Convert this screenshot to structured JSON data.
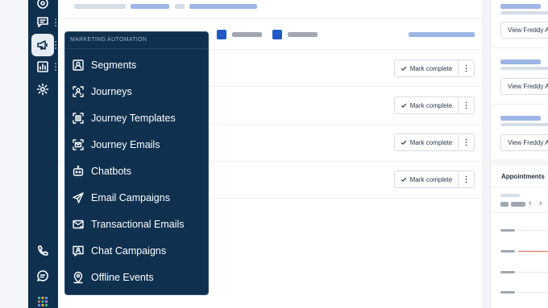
{
  "rail": {
    "icons": [
      "help-icon",
      "chat-icon",
      "megaphone-icon",
      "reports-icon",
      "settings-icon",
      "phone-icon",
      "message-icon",
      "apps-grid-icon"
    ]
  },
  "menu": {
    "section_title": "MARKETING AUTOMATION",
    "items": [
      {
        "label": "Segments",
        "icon": "segments-icon"
      },
      {
        "label": "Journeys",
        "icon": "journeys-icon"
      },
      {
        "label": "Journey Templates",
        "icon": "journey-templates-icon"
      },
      {
        "label": "Journey Emails",
        "icon": "journey-emails-icon"
      },
      {
        "label": "Chatbots",
        "icon": "chatbots-icon"
      },
      {
        "label": "Email Campaigns",
        "icon": "email-campaigns-icon"
      },
      {
        "label": "Transactional Emails",
        "icon": "transactional-emails-icon"
      },
      {
        "label": "Chat Campaigns",
        "icon": "chat-campaigns-icon"
      },
      {
        "label": "Offline Events",
        "icon": "offline-events-icon"
      }
    ]
  },
  "tasks": {
    "mark_complete_label": "Mark complete",
    "more_label": "⋮"
  },
  "right_panel": {
    "view_button_label": "View Freddy AI",
    "appointments_title": "Appointments"
  },
  "colors": {
    "nav_background": "#10304f",
    "accent_blue": "#2258c6",
    "skeleton_blue": "#9db6e6"
  }
}
